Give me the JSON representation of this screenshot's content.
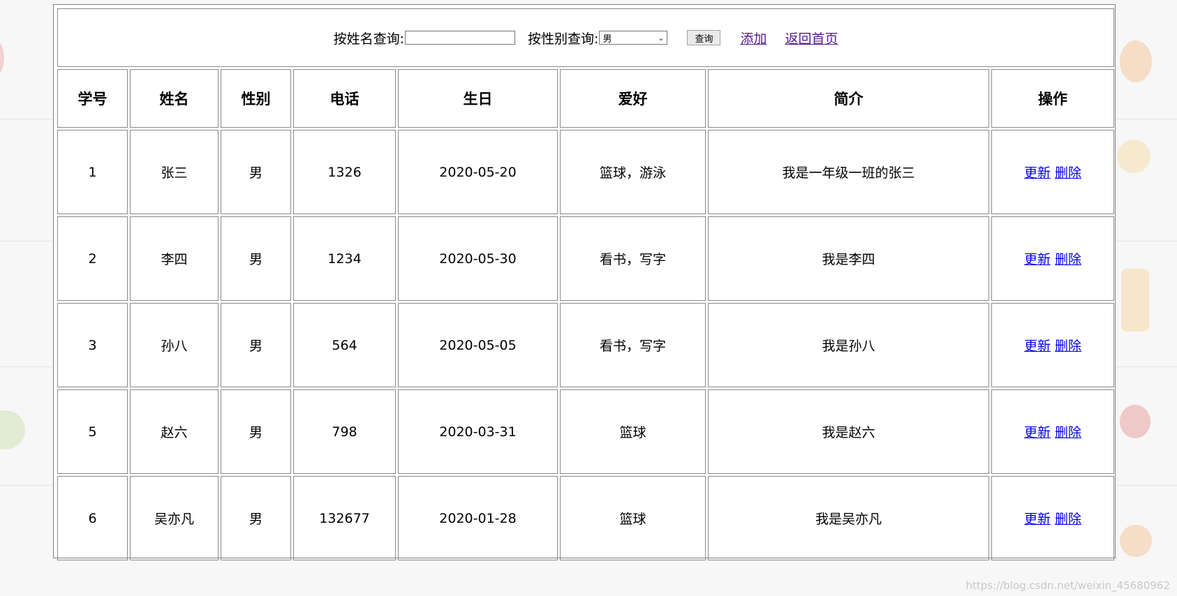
{
  "search": {
    "name_label": "按姓名查询:",
    "name_value": "",
    "sex_label": "按性别查询:",
    "sex_selected": "男",
    "query_button": "查询",
    "add_link": "添加",
    "home_link": "返回首页"
  },
  "table": {
    "headers": [
      "学号",
      "姓名",
      "性别",
      "电话",
      "生日",
      "爱好",
      "简介",
      "操作"
    ],
    "rows": [
      {
        "id": "1",
        "name": "张三",
        "sex": "男",
        "phone": "1326",
        "birthday": "2020-05-20",
        "hobby": "篮球，游泳",
        "intro": "我是一年级一班的张三"
      },
      {
        "id": "2",
        "name": "李四",
        "sex": "男",
        "phone": "1234",
        "birthday": "2020-05-30",
        "hobby": "看书，写字",
        "intro": "我是李四"
      },
      {
        "id": "3",
        "name": "孙八",
        "sex": "男",
        "phone": "564",
        "birthday": "2020-05-05",
        "hobby": "看书，写字",
        "intro": "我是孙八"
      },
      {
        "id": "5",
        "name": "赵六",
        "sex": "男",
        "phone": "798",
        "birthday": "2020-03-31",
        "hobby": "篮球",
        "intro": "我是赵六"
      },
      {
        "id": "6",
        "name": "吴亦凡",
        "sex": "男",
        "phone": "132677",
        "birthday": "2020-01-28",
        "hobby": "篮球",
        "intro": "我是吴亦凡"
      }
    ],
    "update_label": "更新",
    "delete_label": "删除"
  },
  "watermark": "https://blog.csdn.net/weixin_45680962",
  "colors": {
    "link": "#0000ee",
    "visited_link": "#551a8b",
    "border": "#8a8a8a"
  }
}
